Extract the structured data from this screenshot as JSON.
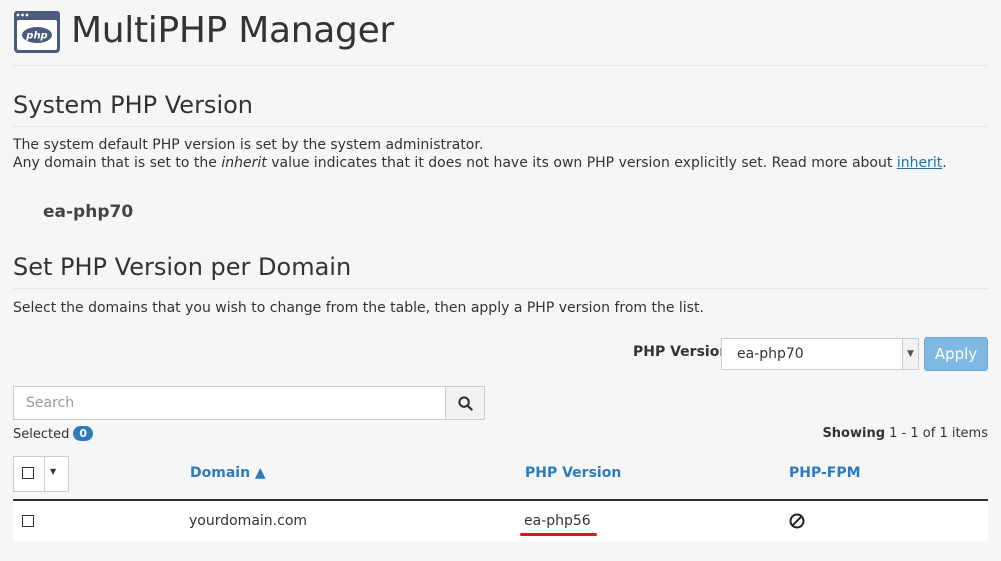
{
  "header": {
    "title": "MultiPHP Manager",
    "logo_text": "php"
  },
  "system": {
    "heading": "System PHP Version",
    "line1": "The system default PHP version is set by the system administrator.",
    "line2_pre": "Any domain that is set to the ",
    "line2_em": "inherit",
    "line2_mid": " value indicates that it does not have its own PHP version explicitly set. Read more about ",
    "line2_link": "inherit",
    "line2_end": ".",
    "version": "ea-php70"
  },
  "per_domain": {
    "heading": "Set PHP Version per Domain",
    "desc": "Select the domains that you wish to change from the table, then apply a PHP version from the list.",
    "php_version_label": "PHP Version",
    "selected_version": "ea-php70",
    "apply_label": "Apply",
    "search_placeholder": "Search",
    "selected_label": "Selected",
    "selected_count": "0",
    "showing_label": "Showing",
    "showing_range": " 1 - 1 of 1 items"
  },
  "table": {
    "columns": {
      "domain": "Domain ▲",
      "php_version": "PHP Version",
      "php_fpm": "PHP-FPM"
    },
    "rows": [
      {
        "domain": "yourdomain.com",
        "php_version": "ea-php56"
      }
    ]
  },
  "colors": {
    "accent": "#2b7bbd",
    "apply_bg": "#7fb8e3",
    "highlight": "#e0141e"
  }
}
